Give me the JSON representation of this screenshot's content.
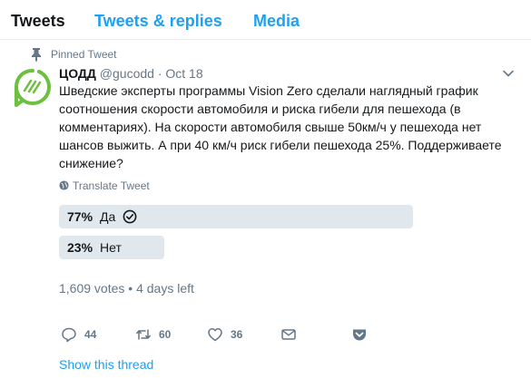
{
  "tabs": [
    {
      "label": "Tweets"
    },
    {
      "label": "Tweets & replies"
    },
    {
      "label": "Media"
    }
  ],
  "tweet": {
    "pinned_label": "Pinned Tweet",
    "author_name": "ЦОДД",
    "author_handle": "@gucodd",
    "separator": "·",
    "date": "Oct 18",
    "text": "Шведские эксперты программы Vision Zero сделали наглядный график соотношения скорости автомобиля и риска гибели для пешехода (в комментариях). На скорости автомобиля свыше 50км/ч у пешехода нет шансов выжить. А при 40 км/ч риск гибели пешехода 25%. Поддерживаете снижение?",
    "translate_label": "Translate Tweet",
    "poll": {
      "options": [
        {
          "percent": "77%",
          "label": "Да",
          "fraction": 0.77,
          "selected": true
        },
        {
          "percent": "23%",
          "label": "Нет",
          "fraction": 0.23,
          "selected": false
        }
      ],
      "meta": "1,609 votes • 4 days left"
    },
    "actions": {
      "reply_count": "44",
      "retweet_count": "60",
      "like_count": "36",
      "dm_count": "",
      "save_count": ""
    },
    "show_thread": "Show this thread"
  },
  "colors": {
    "accent": "#1da1f2",
    "muted": "#657786",
    "logo_green": "#6cbf3f",
    "poll_bar": "#e1e8ed"
  }
}
